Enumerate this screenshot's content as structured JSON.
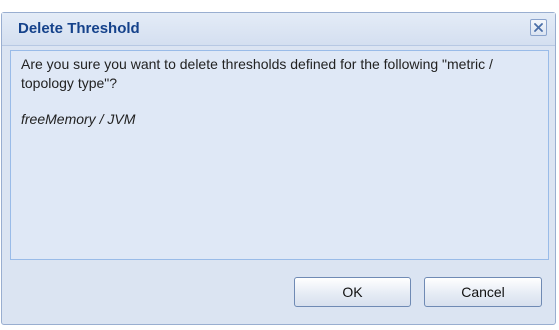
{
  "dialog": {
    "title": "Delete Threshold",
    "message": "Are you sure you want to delete thresholds defined for the following \"metric / topology type\"?",
    "target": "freeMemory / JVM",
    "ok_label": "OK",
    "cancel_label": "Cancel",
    "close_icon": "close-icon"
  },
  "colors": {
    "title_text": "#15428b",
    "panel_background": "#dfe8f6",
    "dialog_background": "#dbe4f2",
    "border": "#99bbe8"
  }
}
